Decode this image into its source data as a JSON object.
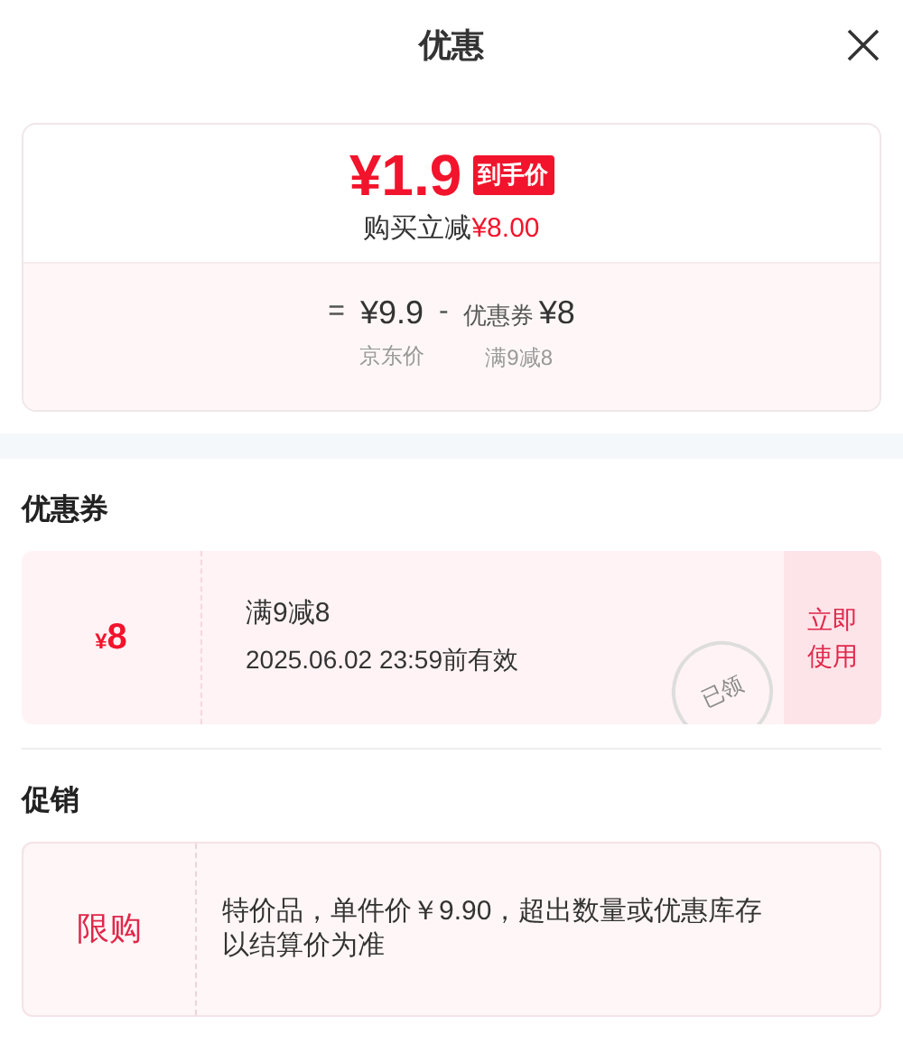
{
  "header": {
    "title": "优惠"
  },
  "price_card": {
    "final_price": "¥1.9",
    "price_tag": "到手价",
    "saving_label": "购买立减",
    "saving_amount": "¥8.00",
    "formula": [
      {
        "kind": "sign",
        "text": "="
      },
      {
        "kind": "amount",
        "text": "¥9.9",
        "caption": "京东价"
      },
      {
        "kind": "sign",
        "text": "-"
      },
      {
        "kind": "amount",
        "prefix": "优惠券",
        "text": "¥8",
        "caption": "满9减8"
      }
    ]
  },
  "coupons": {
    "title": "优惠券",
    "items": [
      {
        "currency": "¥",
        "amount": "8",
        "rule": "满9减8",
        "validity": "2025.06.02 23:59前有效",
        "stamp": "已领",
        "action": "立即使用"
      }
    ]
  },
  "promotions": {
    "title": "促销",
    "items": [
      {
        "tag": "限购",
        "text": "特价品，单件价￥9.90，超出数量或优惠库存以结算价为准"
      }
    ]
  }
}
